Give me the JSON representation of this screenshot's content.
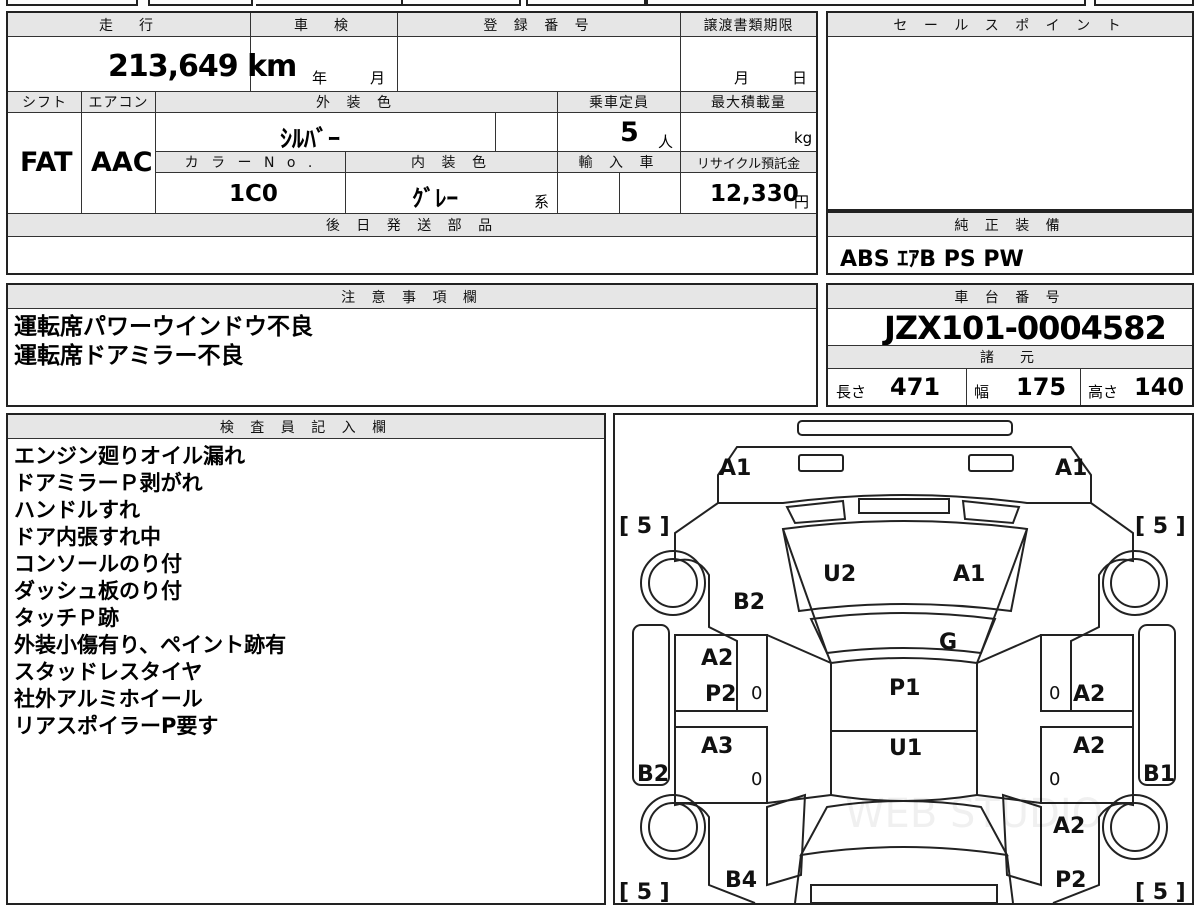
{
  "sheet": {
    "mileage_label": "走　行",
    "mileage_value": "213,649 km",
    "inspection_label": "車　検",
    "inspection_year": "年",
    "inspection_month": "月",
    "reg_label": "登 録 番 号",
    "transfer_label": "譲渡書類期限",
    "transfer_month": "月",
    "transfer_day": "日",
    "shift_label": "シフト",
    "shift_value": "FAT",
    "aircon_label": "エアコン",
    "aircon_value": "AAC",
    "exterior_label": "外 装 色",
    "exterior_value": "ｼﾙﾊﾞｰ",
    "capacity_label": "乗車定員",
    "capacity_value": "5",
    "capacity_unit": "人",
    "maxload_label": "最大積載量",
    "maxload_unit": "kg",
    "colorno_label": "カ ラ ー N o .",
    "colorno_value": "1C0",
    "interior_label": "内 装 色",
    "interior_value": "ｸﾞﾚｰ",
    "interior_suffix": "系",
    "import_label": "輸 入 車",
    "recycle_label": "リサイクル預託金",
    "recycle_value": "12,330",
    "recycle_unit": "円",
    "later_parts_label": "後 日 発 送 部 品"
  },
  "sales": {
    "label": "セ ー ル ス ポ イ ン ト"
  },
  "equipment": {
    "label": "純 正 装 備",
    "value": "ABS ｴｱB PS PW"
  },
  "notes": {
    "label": "注 意 事 項 欄",
    "lines": [
      "運転席パワーウインドウ不良",
      "運転席ドアミラー不良"
    ]
  },
  "chassis": {
    "label": "車 台 番 号",
    "value": "JZX101-0004582",
    "specs_label": "諸　元",
    "length_label": "長さ",
    "length_value": "471",
    "width_label": "幅",
    "width_value": "175",
    "height_label": "高さ",
    "height_value": "140"
  },
  "inspector": {
    "label": "検 査 員 記 入 欄",
    "lines": [
      "エンジン廻りオイル漏れ",
      "ドアミラーＰ剥がれ",
      "ハンドルすれ",
      "ドア内張すれ中",
      "コンソールのり付",
      "ダッシュ板のり付",
      "タッチＰ跡",
      "外装小傷有り、ペイント跡有",
      "スタッドレスタイヤ",
      "社外アルミホイール",
      "リアスポイラーP要す"
    ]
  },
  "diagram": {
    "tire_tl": "[ 5 ]",
    "tire_tr": "[ 5 ]",
    "tire_bl": "[ 5 ]",
    "tire_br": "[ 5 ]",
    "front_l": "A1",
    "front_r": "A1",
    "hood_l": "U2",
    "hood_r": "A1",
    "fender_l": "B2",
    "roof_g": "G",
    "door_fl": "A2",
    "door_fl2": "P2",
    "door_fl_zero": "0",
    "door_rl": "A3",
    "door_rl_zero": "0",
    "roof": "P1",
    "roof2": "U1",
    "door_fr": "A2",
    "door_fr_zero": "0",
    "door_rr": "A2",
    "door_rr_zero": "0",
    "quarter_l": "B2",
    "quarter_r": "B1",
    "rear_r": "A2",
    "rear_bl": "B4",
    "rear_br": "P2",
    "watermark": "WEB STUDIO"
  }
}
